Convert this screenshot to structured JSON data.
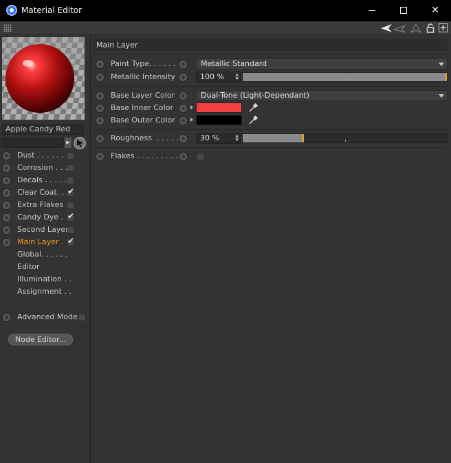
{
  "window": {
    "title": "Material Editor"
  },
  "material": {
    "name": "Apple Candy Red",
    "preview_colors": {
      "sphere": "#c01818",
      "highlight": "#ff8080",
      "checker_light": "#b8b8b8",
      "checker_dark": "#7a7a7a"
    }
  },
  "channels": [
    {
      "label": "Dust . . . . . . .",
      "checked": false,
      "radio": true
    },
    {
      "label": "Corrosion . . .",
      "checked": false,
      "radio": true
    },
    {
      "label": "Decals . . . . . .",
      "checked": false,
      "radio": true
    },
    {
      "label": "Clear Coat. . .",
      "checked": true,
      "radio": true
    },
    {
      "label": "Extra Flakes",
      "checked": false,
      "radio": true
    },
    {
      "label": "Candy Dye . .",
      "checked": true,
      "radio": true
    },
    {
      "label": "Second Layer",
      "checked": false,
      "radio": true
    },
    {
      "label": "Main Layer . .",
      "checked": true,
      "radio": true,
      "active": true
    },
    {
      "label": "Global. . . . . .",
      "radio": false
    },
    {
      "label": "Editor",
      "radio": false
    },
    {
      "label": "Illumination . .",
      "radio": false
    },
    {
      "label": "Assignment . .",
      "radio": false
    }
  ],
  "node_editor_label": "Node Editor...",
  "advanced_mode_label": "Advanced Mode",
  "section_title": "Main Layer",
  "params": {
    "paint_type": {
      "label": "Paint Type. . . . . . .",
      "value": "Metallic Standard"
    },
    "metallic_intensity": {
      "label": "Metallic Intensity",
      "value": "100 %",
      "fraction": 1.0
    },
    "base_layer_color": {
      "label": "Base Layer Color",
      "value": "Dual-Tone (Light-Dependant)"
    },
    "base_inner_color": {
      "label": "Base Inner Color",
      "color": "#f04040"
    },
    "base_outer_color": {
      "label": "Base Outer Color",
      "color": "#000000"
    },
    "roughness": {
      "label": "Roughness  . . . . .",
      "value": "30 %",
      "fraction": 0.3
    },
    "flakes": {
      "label": "Flakes . . . . . . . . . .",
      "checked": false
    }
  },
  "colors": {
    "accent": "#f39a2a",
    "panel": "#333333"
  }
}
